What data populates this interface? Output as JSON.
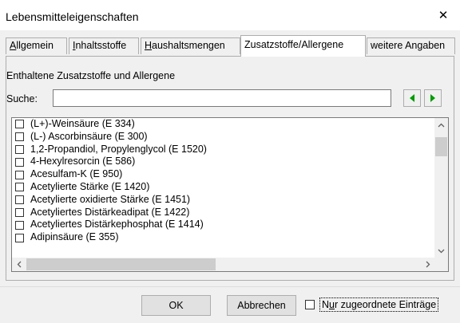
{
  "window": {
    "title": "Lebensmitteleigenschaften",
    "close_glyph": "✕"
  },
  "tabs": [
    {
      "pre": "",
      "mnemonic": "A",
      "post": "llgemein"
    },
    {
      "pre": "",
      "mnemonic": "I",
      "post": "nhaltsstoffe"
    },
    {
      "pre": "",
      "mnemonic": "H",
      "post": "aushaltsmengen"
    },
    {
      "pre": "Zusatzstoffe/Allergene",
      "mnemonic": "",
      "post": ""
    },
    {
      "pre": "weitere Angaben",
      "mnemonic": "",
      "post": ""
    }
  ],
  "panel": {
    "section_label": "Enthaltene Zusatzstoffe und Allergene",
    "search": {
      "label": "Suche:",
      "value": ""
    },
    "items": [
      "(L+)-Weinsäure (E 334)",
      "(L-) Ascorbinsäure (E 300)",
      "1,2-Propandiol, Propylenglycol (E 1520)",
      "4-Hexylresorcin (E 586)",
      "Acesulfam-K (E 950)",
      "Acetylierte Stärke (E 1420)",
      "Acetylierte oxidierte Stärke (E 1451)",
      "Acetyliertes Distärkeadipat (E 1422)",
      "Acetyliertes Distärkephosphat (E 1414)",
      "Adipinsäure (E 355)"
    ]
  },
  "buttons": {
    "ok": "OK",
    "cancel": "Abbrechen"
  },
  "filter": {
    "pre": "N",
    "mnemonic": "u",
    "post": "r zugeordnete Einträge"
  },
  "colors": {
    "nav_arrow": "#00a000",
    "focus": "#0078d7"
  }
}
